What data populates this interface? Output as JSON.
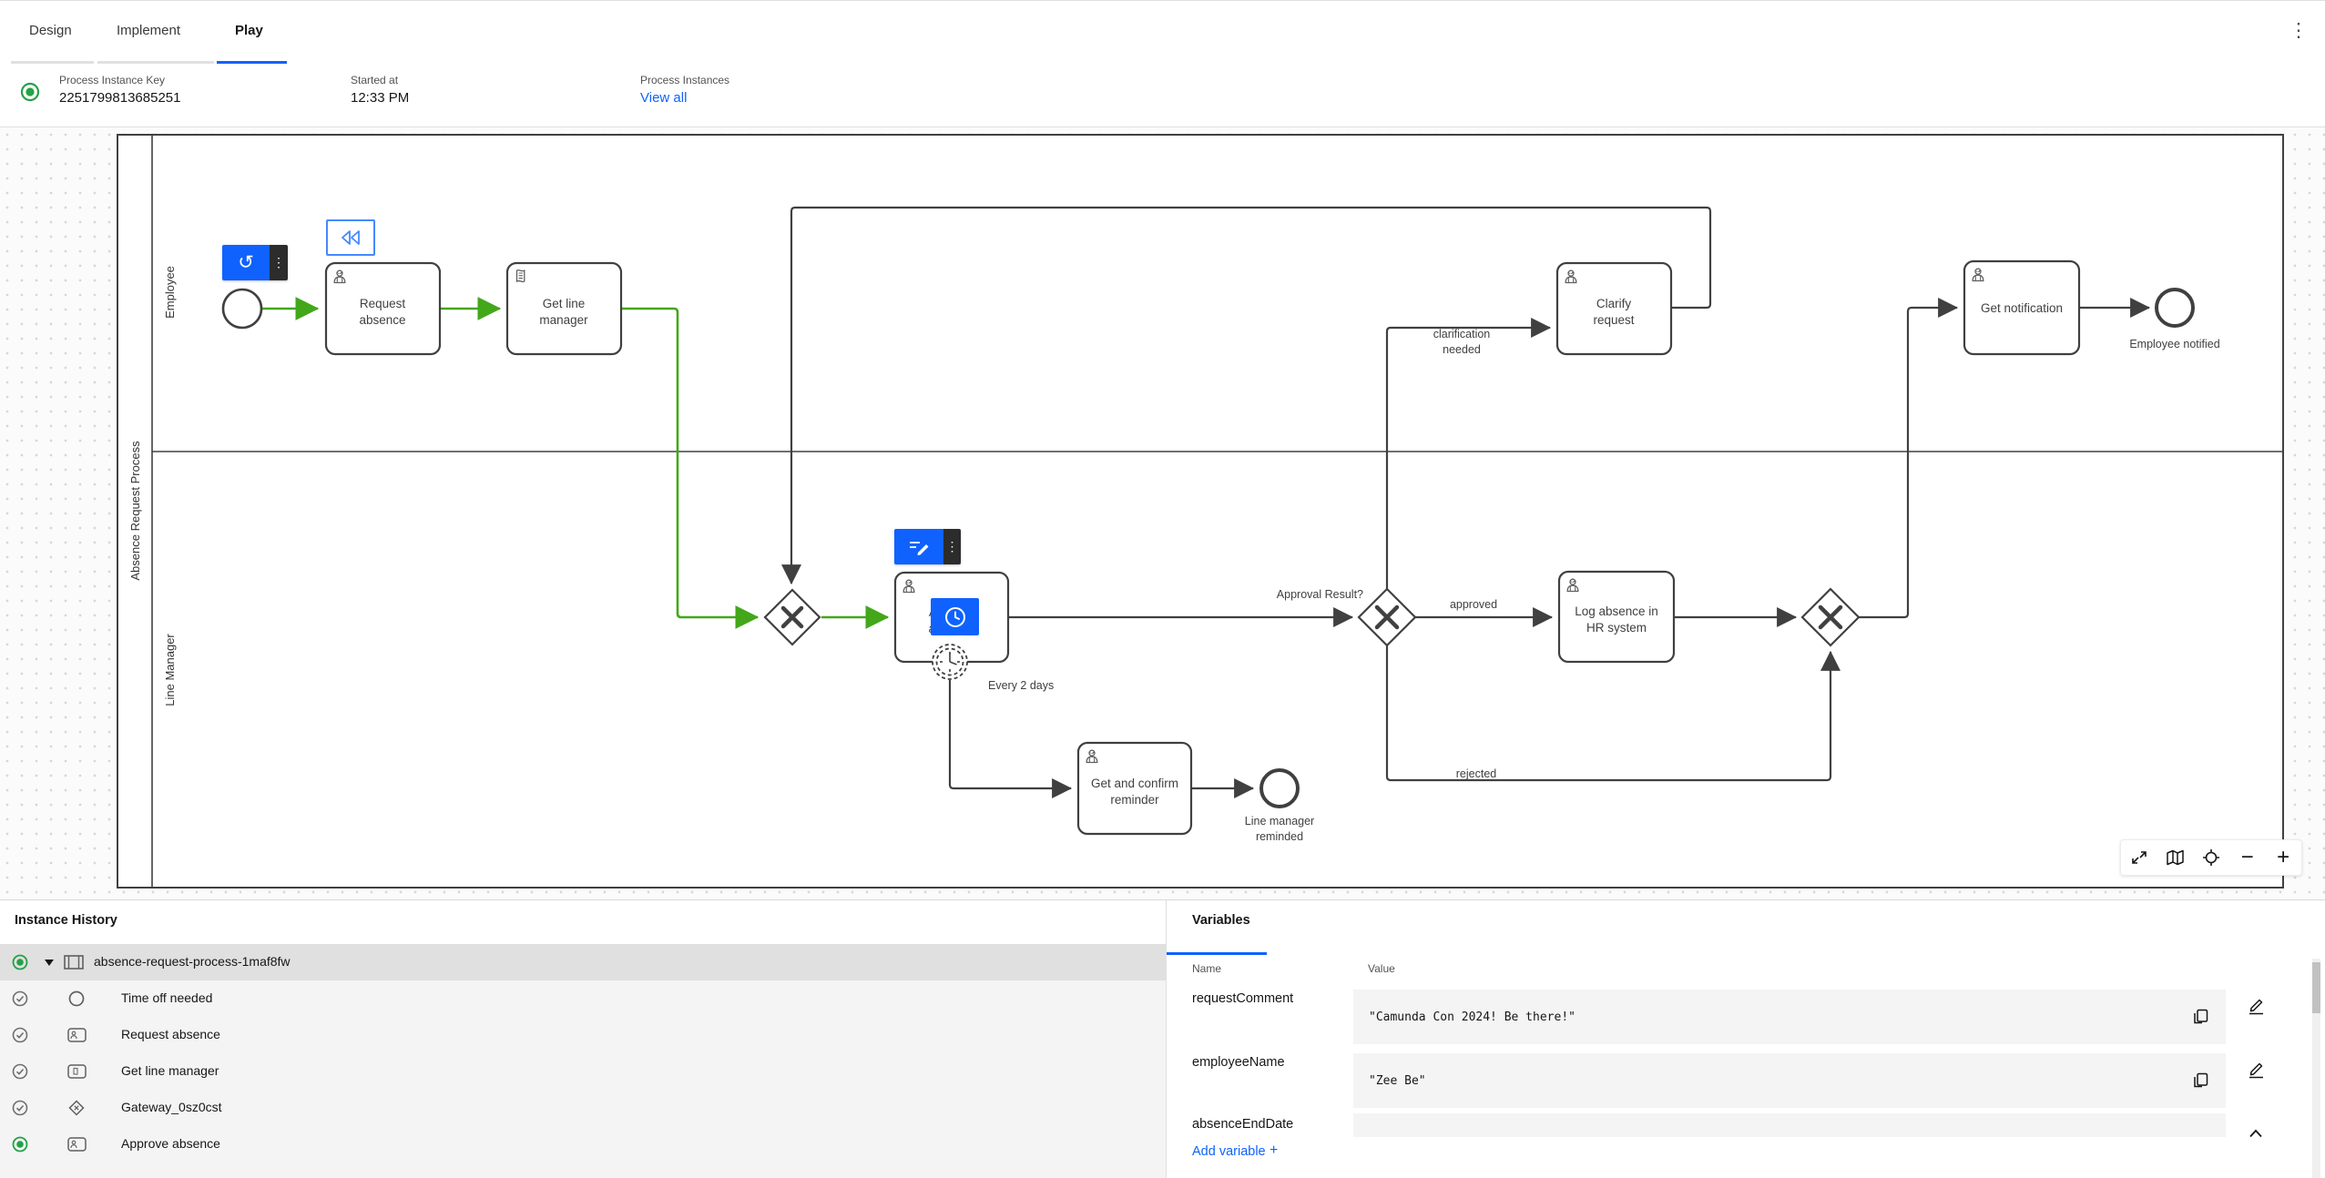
{
  "header": {
    "tabs": [
      {
        "label": "Design"
      },
      {
        "label": "Implement"
      },
      {
        "label": "Play"
      }
    ],
    "active_tab": "Play",
    "menu_icon": "kebab-vertical-icon"
  },
  "infobar": {
    "instance_key_label": "Process Instance Key",
    "instance_key_value": "2251799813685251",
    "started_label": "Started at",
    "started_value": "12:33 PM",
    "process_instances_label": "Process Instances",
    "view_all": "View all",
    "status_icon": "active-instance-radio"
  },
  "diagram": {
    "pool": "Absence Request Process",
    "lanes": [
      {
        "label": "Employee"
      },
      {
        "label": "Line Manager"
      }
    ],
    "tasks": [
      {
        "lines": [
          "Request",
          "absence"
        ],
        "icon": "user-task-icon"
      },
      {
        "lines": [
          "Get line",
          "manager"
        ],
        "icon": "script-task-icon"
      },
      {
        "lines": [
          "Approve",
          "absence"
        ],
        "icon": "user-task-icon"
      },
      {
        "lines": [
          "Log absence in",
          "HR system"
        ],
        "icon": "user-task-icon"
      },
      {
        "lines": [
          "Clarify",
          "request"
        ],
        "icon": "user-task-icon"
      },
      {
        "lines": [
          "Get notification"
        ],
        "icon": "user-task-icon"
      },
      {
        "lines": [
          "Get and confirm",
          "reminder"
        ],
        "icon": "user-task-icon"
      }
    ],
    "labels": {
      "clarification": [
        "clarification",
        "needed"
      ],
      "approval_result": "Approval Result?",
      "approved": "approved",
      "rejected": "rejected",
      "timer": "Every 2 days",
      "employee_notified": "Employee notified",
      "line_manager_reminded": [
        "Line manager",
        "reminded"
      ]
    },
    "overlay_icons": [
      "restart-icon",
      "kebab-vertical-icon",
      "rewind-icon",
      "form-edit-icon",
      "clock-icon"
    ],
    "toolbar_icons": [
      "fit-viewport-icon",
      "minimap-icon",
      "reset-zoom-icon",
      "zoom-out-icon",
      "zoom-in-icon"
    ]
  },
  "history": {
    "title": "Instance History",
    "rows": [
      {
        "icon": "process-icon",
        "label": "absence-request-process-1maf8fw",
        "state": "active",
        "selected": true
      },
      {
        "icon": "start-event-icon",
        "label": "Time off needed",
        "state": "completed"
      },
      {
        "icon": "user-task-icon",
        "label": "Request absence",
        "state": "completed"
      },
      {
        "icon": "script-task-icon",
        "label": "Get line manager",
        "state": "completed"
      },
      {
        "icon": "gateway-icon",
        "label": "Gateway_0sz0cst",
        "state": "completed"
      },
      {
        "icon": "user-task-icon",
        "label": "Approve absence",
        "state": "active"
      }
    ]
  },
  "variables": {
    "tab": "Variables",
    "name_header": "Name",
    "value_header": "Value",
    "rows": [
      {
        "name": "requestComment",
        "value": "\"Camunda Con 2024! Be there!\""
      },
      {
        "name": "employeeName",
        "value": "\"Zee Be\""
      },
      {
        "name": "absenceEndDate",
        "value": ""
      }
    ],
    "add_variable": "Add variable",
    "plus": "+"
  },
  "colors": {
    "accent_blue": "#0f62fe",
    "success_green": "#24a148",
    "completed_flow_green": "#43a71a",
    "shape_stroke": "#404040"
  }
}
